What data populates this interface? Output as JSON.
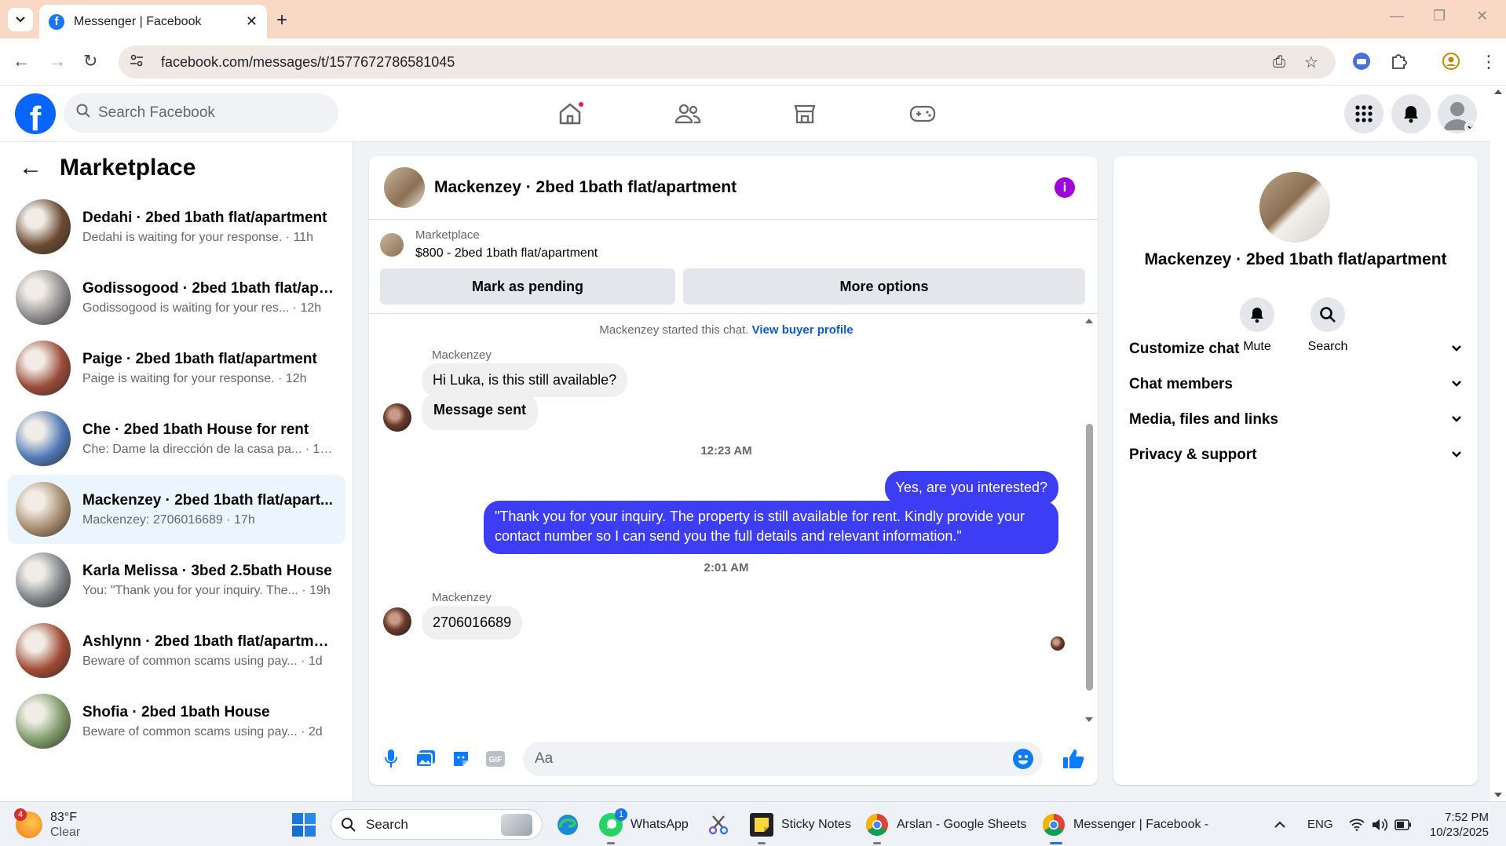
{
  "browser": {
    "tab_title": "Messenger | Facebook",
    "url": "facebook.com/messages/t/1577672786581045"
  },
  "fb": {
    "search_placeholder": "Search Facebook"
  },
  "sidebar": {
    "title": "Marketplace",
    "conversations": [
      {
        "name": "Dedahi · 2bed 1bath flat/apartment",
        "preview": "Dedahi is waiting for your response. · 11h",
        "thumb": "#6b4a33"
      },
      {
        "name": "Godissogood · 2bed 1bath flat/apa...",
        "preview": "Godissogood is waiting for your res... · 12h",
        "thumb": "#8f8f90"
      },
      {
        "name": "Paige · 2bed 1bath flat/apartment",
        "preview": "Paige is waiting for your response. · 12h",
        "thumb": "#9b4a3a"
      },
      {
        "name": "Che · 2bed 1bath House for rent",
        "preview": "Che: Dame la dirección de la casa pa... · 16h",
        "thumb": "#4f79b8"
      },
      {
        "name": "Mackenzey · 2bed 1bath flat/apart...",
        "preview": "Mackenzey: 2706016689 · 17h",
        "thumb": "#a98d70"
      },
      {
        "name": "Karla Melissa · 3bed 2.5bath House",
        "preview": "You: \"Thank you for your inquiry. The... · 19h",
        "thumb": "#7d848a"
      },
      {
        "name": "Ashlynn · 2bed 1bath flat/apartment",
        "preview": "Beware of common scams using pay... · 1d",
        "thumb": "#a04a35"
      },
      {
        "name": "Shofia · 2bed 1bath House",
        "preview": "Beware of common scams using pay... · 2d",
        "thumb": "#7d9a6a"
      }
    ]
  },
  "chat": {
    "title": "Mackenzey · 2bed 1bath flat/apartment",
    "listing_source": "Marketplace",
    "listing_price": "$800 - 2bed 1bath flat/apartment",
    "mark_pending": "Mark as pending",
    "more_options": "More options",
    "system_text": "Mackenzey started this chat.",
    "system_link": "View buyer profile",
    "sender_1": "Mackenzey",
    "msg_1": "Hi Luka, is this still available?",
    "msg_2": "Message sent",
    "time_1": "12:23 AM",
    "msg_3": "Yes, are you interested?",
    "msg_4": "\"Thank you for your inquiry. The property is still available for rent. Kindly provide your contact number so I can send you the full details and relevant information.\"",
    "time_2": "2:01 AM",
    "sender_2": "Mackenzey",
    "msg_5": "2706016689",
    "composer_placeholder": "Aa"
  },
  "right_panel": {
    "name": "Mackenzey · 2bed 1bath flat/apartment",
    "mute": "Mute",
    "search": "Search",
    "sections": [
      "Customize chat",
      "Chat members",
      "Media, files and links",
      "Privacy & support"
    ]
  },
  "taskbar": {
    "weather_temp": "83°F",
    "weather_desc": "Clear",
    "weather_badge": "4",
    "search": "Search",
    "whatsapp": "WhatsApp",
    "whatsapp_badge": "1",
    "sticky": "Sticky Notes",
    "sheets": "Arslan - Google Sheets",
    "messenger": "Messenger | Facebook -",
    "lang": "ENG",
    "time": "7:52 PM",
    "date": "10/23/2025"
  },
  "colors": {
    "fb_blue": "#0866ff",
    "outgoing_bubble": "#3d3df5",
    "active_conv": "#ebf5ff",
    "info_purple": "#a100dd"
  }
}
